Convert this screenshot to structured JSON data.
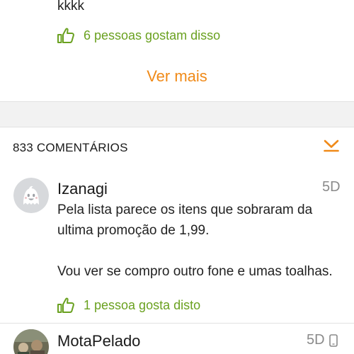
{
  "previous_comment": {
    "text": "kkkk",
    "likes_label": "6 pessoas gostam disso"
  },
  "see_more_label": "Ver mais",
  "comments_section": {
    "header": "833 COMENTÁRIOS",
    "sort_icon": "chevron-down-underline-icon",
    "accent_color": "#f08a18",
    "like_color": "#6aa120"
  },
  "comments": [
    {
      "username": "Izanagi",
      "age": "5D",
      "avatar_icon": "ghost-avatar-icon",
      "paragraphs": [
        "Pela lista parece os itens que sobraram da ultima promoção de 1,99.",
        "Vou ver se compro outro fone e umas toalhas."
      ],
      "likes_label": "1 pessoa gosta disto"
    },
    {
      "username": "MotaPelado",
      "age": "5D",
      "avatar_icon": "photo-avatar",
      "device_icon": "phone-icon"
    }
  ]
}
